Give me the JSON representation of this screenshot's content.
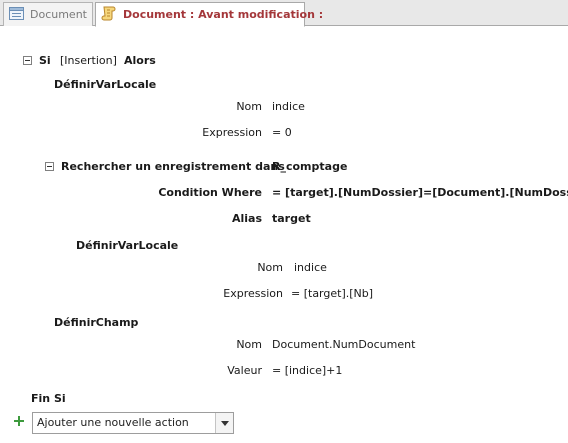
{
  "tabs": {
    "inactive_label": "Document",
    "active_label": "Document : Avant modification :"
  },
  "macro": {
    "if_keyword": "Si",
    "condition": "[Insertion]",
    "then_keyword": "Alors",
    "setlocalvar1": {
      "action": "DéfinirVarLocale",
      "name_label": "Nom",
      "name_value": "indice",
      "expr_label": "Expression",
      "expr_value": "= 0"
    },
    "lookup": {
      "action": "Rechercher un enregistrement dans",
      "table": "R_comptage",
      "where_label": "Condition Where",
      "where_value": "= [target].[NumDossier]=[Document].[NumDossier]",
      "alias_label": "Alias",
      "alias_value": "target"
    },
    "setlocalvar2": {
      "action": "DéfinirVarLocale",
      "name_label": "Nom",
      "name_value": "indice",
      "expr_label": "Expression",
      "expr_value": "= [target].[Nb]"
    },
    "setfield": {
      "action": "DéfinirChamp",
      "name_label": "Nom",
      "name_value": "Document.NumDocument",
      "value_label": "Valeur",
      "value_value": "= [indice]+1"
    },
    "end_if": "Fin Si"
  },
  "add_action": {
    "selected": "Ajouter une nouvelle action"
  }
}
